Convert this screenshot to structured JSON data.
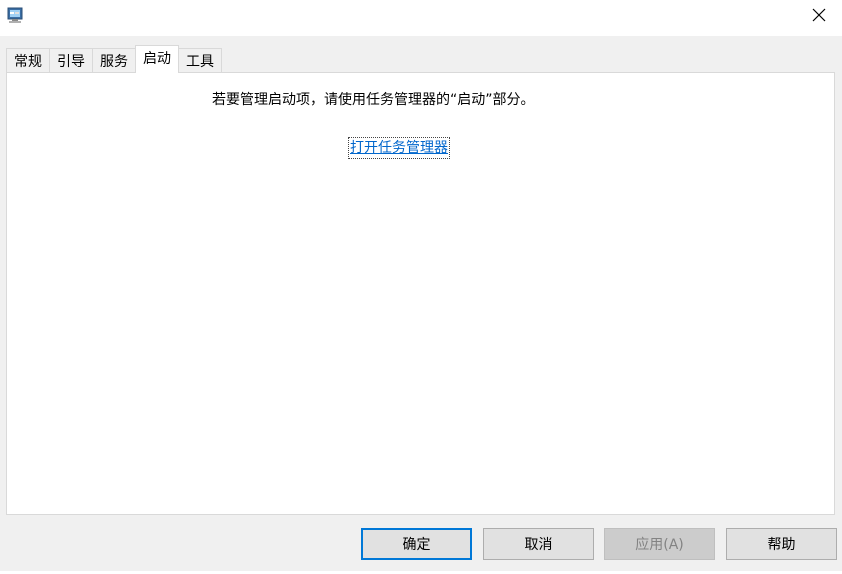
{
  "window": {
    "icon": "msconfig-computer-icon",
    "close_icon": "close-icon"
  },
  "tabs": [
    {
      "label": "常规",
      "active": false
    },
    {
      "label": "引导",
      "active": false
    },
    {
      "label": "服务",
      "active": false
    },
    {
      "label": "启动",
      "active": true
    },
    {
      "label": "工具",
      "active": false
    }
  ],
  "startup_panel": {
    "message": "若要管理启动项，请使用任务管理器的“启动”部分。",
    "link_label": "打开任务管理器"
  },
  "buttons": {
    "ok": "确定",
    "cancel": "取消",
    "apply": "应用(A)",
    "help": "帮助"
  },
  "colors": {
    "link": "#0066cc",
    "default_button_border": "#0078d7",
    "window_bg": "#f0f0f0"
  }
}
